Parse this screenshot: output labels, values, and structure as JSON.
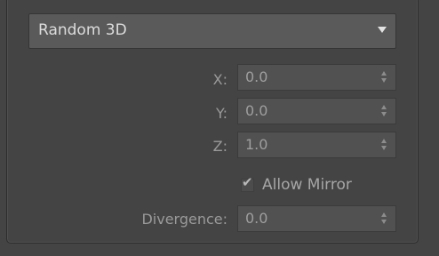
{
  "dropdown": {
    "selected": "Random 3D",
    "icon": "chevron-down-icon"
  },
  "fields": {
    "x": {
      "label": "X:",
      "value": "0.0"
    },
    "y": {
      "label": "Y:",
      "value": "0.0"
    },
    "z": {
      "label": "Z:",
      "value": "1.0"
    },
    "divergence": {
      "label": "Divergence:",
      "value": "0.0"
    }
  },
  "allow_mirror": {
    "label": "Allow Mirror",
    "checked": true
  }
}
